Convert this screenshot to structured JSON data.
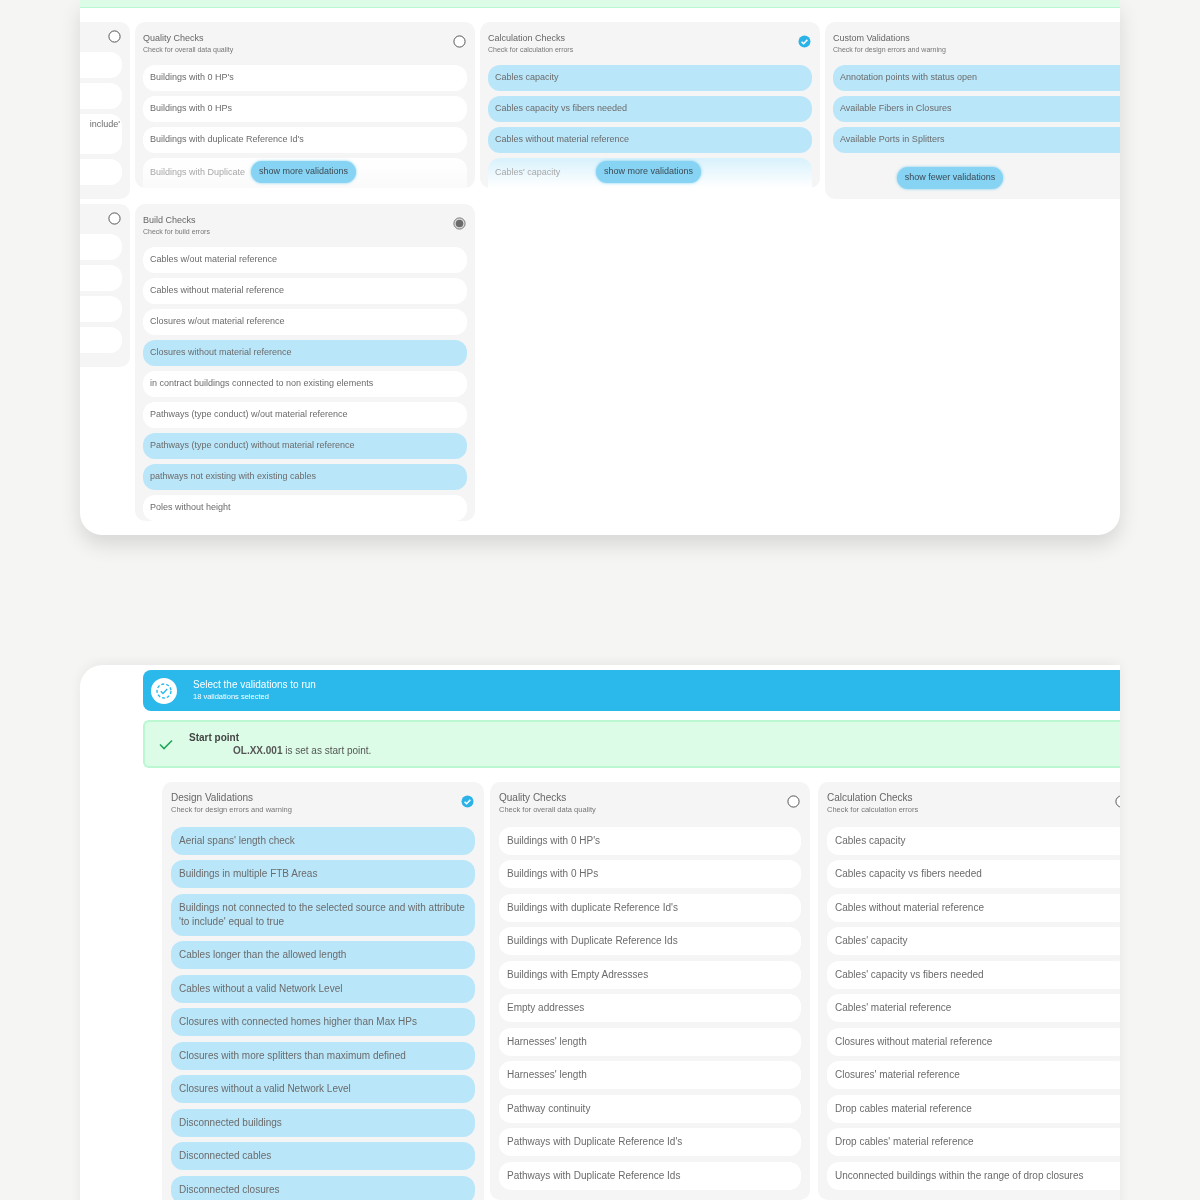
{
  "top_view": {
    "rows": [
      [
        {
          "kind": "cut",
          "checked": false,
          "indeterminate": false,
          "items": [
            {
              "kind": "blank"
            },
            {
              "kind": "blank"
            },
            {
              "kind": "text",
              "text": "include'"
            },
            {
              "kind": "blank"
            }
          ]
        },
        {
          "kind": "full",
          "title": "Quality Checks",
          "subtitle": "Check for overall data quality",
          "checked": false,
          "indeterminate": false,
          "items": [
            {
              "text": "Buildings with 0 HP's",
              "selected": false
            },
            {
              "text": "Buildings with 0 HPs",
              "selected": false
            },
            {
              "text": "Buildings with duplicate Reference Id's",
              "selected": false
            }
          ],
          "more": {
            "faded_item": "Buildings with Duplicate",
            "button": "show more validations",
            "faded_selected": false
          }
        },
        {
          "kind": "full",
          "title": "Calculation Checks",
          "subtitle": "Check for calculation errors",
          "checked": true,
          "items": [
            {
              "text": "Cables capacity",
              "selected": true
            },
            {
              "text": "Cables capacity vs fibers needed",
              "selected": true
            },
            {
              "text": "Cables without material reference",
              "selected": true
            }
          ],
          "more": {
            "faded_item": "Cables' capacity",
            "button": "show more validations",
            "faded_selected": true
          }
        },
        {
          "kind": "full",
          "title": "Custom Validations",
          "subtitle": "Check for design errors and warning",
          "items": [
            {
              "text": "Annotation points with status open",
              "selected": true
            },
            {
              "text": "Available Fibers in Closures",
              "selected": true
            },
            {
              "text": "Available Ports in Splitters",
              "selected": true
            }
          ],
          "fewer": {
            "button": "show fewer validations"
          }
        }
      ],
      [
        {
          "kind": "cut",
          "checked": false,
          "indeterminate": false,
          "items": [
            {
              "kind": "blank"
            },
            {
              "kind": "blank"
            },
            {
              "kind": "blank"
            },
            {
              "kind": "blank"
            }
          ]
        },
        {
          "kind": "full",
          "title": "Build Checks",
          "subtitle": "Check for build errors",
          "checked": false,
          "indeterminate": true,
          "items": [
            {
              "text": "Cables w/out material reference",
              "selected": false
            },
            {
              "text": "Cables without material reference",
              "selected": false
            },
            {
              "text": "Closures w/out material reference",
              "selected": false
            },
            {
              "text": "Closures without material reference",
              "selected": true
            },
            {
              "text": "in contract buildings connected to non existing elements",
              "selected": false
            },
            {
              "text": "Pathways (type conduct) w/out material reference",
              "selected": false
            },
            {
              "text": "Pathways (type conduct) without material reference",
              "selected": true
            },
            {
              "text": "pathways not existing with existing cables",
              "selected": true
            },
            {
              "text": "Poles without height",
              "selected": false
            }
          ]
        }
      ]
    ]
  },
  "bottom_view": {
    "header": {
      "title": "Select the validations to run",
      "subtitle": "18 validations selected"
    },
    "alert": {
      "title": "Start point",
      "message": "**OL.XX.001** is set as start point."
    },
    "cards": [
      {
        "title": "Design Validations",
        "subtitle": "Check for design errors and warning",
        "checked": true,
        "items": [
          {
            "text": "Aerial spans' length check",
            "selected": true
          },
          {
            "text": "Buildings in multiple FTB Areas",
            "selected": true
          },
          {
            "text": "Buildings not connected to the selected source and with attribute 'to include' equal to true",
            "selected": true
          },
          {
            "text": "Cables longer than the allowed length",
            "selected": true
          },
          {
            "text": "Cables without a valid Network Level",
            "selected": true
          },
          {
            "text": "Closures with connected homes higher than Max HPs",
            "selected": true
          },
          {
            "text": "Closures with more splitters than maximum defined",
            "selected": true
          },
          {
            "text": "Closures without a valid Network Level",
            "selected": true
          },
          {
            "text": "Disconnected buildings",
            "selected": true
          },
          {
            "text": "Disconnected cables",
            "selected": true
          },
          {
            "text": "Disconnected closures",
            "selected": true
          }
        ]
      },
      {
        "title": "Quality Checks",
        "subtitle": "Check for overall data quality",
        "checked": false,
        "indeterminate": false,
        "items": [
          {
            "text": "Buildings with 0 HP's",
            "selected": false
          },
          {
            "text": "Buildings with 0 HPs",
            "selected": false
          },
          {
            "text": "Buildings with duplicate Reference Id's",
            "selected": false
          },
          {
            "text": "Buildings with Duplicate Reference Ids",
            "selected": false
          },
          {
            "text": "Buildings with Empty Adressses",
            "selected": false
          },
          {
            "text": "Empty addresses",
            "selected": false
          },
          {
            "text": "Harnesses' length",
            "selected": false
          },
          {
            "text": "Harnesses' length",
            "selected": false
          },
          {
            "text": "Pathway continuity",
            "selected": false
          },
          {
            "text": "Pathways with Duplicate Reference Id's",
            "selected": false
          },
          {
            "text": "Pathways with Duplicate Reference Ids",
            "selected": false
          }
        ]
      },
      {
        "title": "Calculation Checks",
        "subtitle": "Check for calculation errors",
        "checked": false,
        "indeterminate": false,
        "items": [
          {
            "text": "Cables capacity",
            "selected": false
          },
          {
            "text": "Cables capacity vs fibers needed",
            "selected": false
          },
          {
            "text": "Cables without material reference",
            "selected": false
          },
          {
            "text": "Cables' capacity",
            "selected": false
          },
          {
            "text": "Cables' capacity vs fibers needed",
            "selected": false
          },
          {
            "text": "Cables' material reference",
            "selected": false
          },
          {
            "text": "Closures without material reference",
            "selected": false
          },
          {
            "text": "Closures' material reference",
            "selected": false
          },
          {
            "text": "Drop cables material reference",
            "selected": false
          },
          {
            "text": "Drop cables' material reference",
            "selected": false
          },
          {
            "text": "Unconnected buildings within the range of drop closures",
            "selected": false
          }
        ]
      }
    ]
  }
}
